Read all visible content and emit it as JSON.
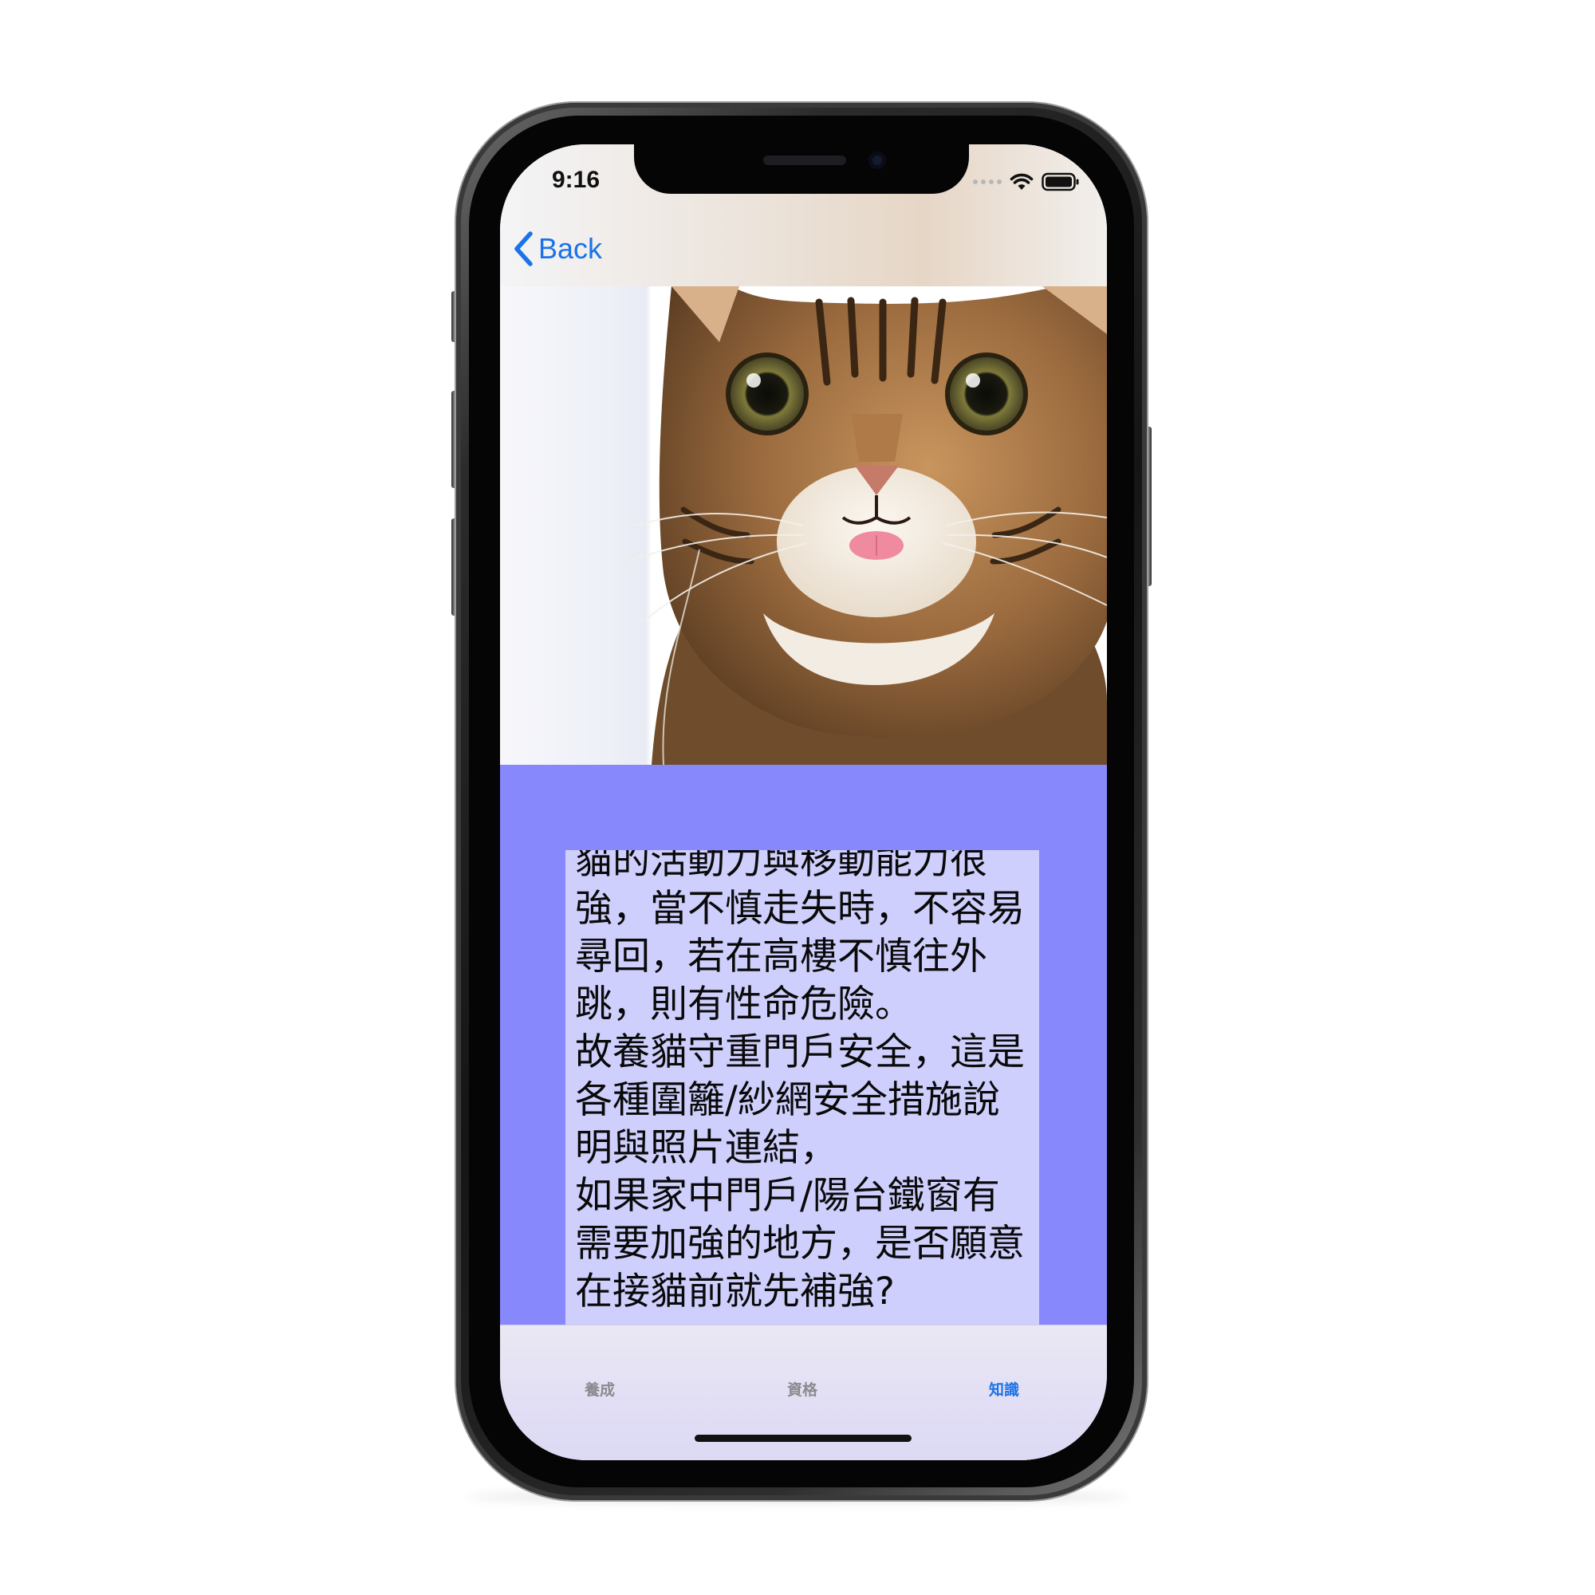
{
  "status_bar": {
    "time": "9:16"
  },
  "nav": {
    "back_label": "Back"
  },
  "content": {
    "body": "貓的活動力與移動能力很強，當不慎走失時，不容易尋回，若在高樓不慎往外跳，則有性命危險。\n故養貓守重門戶安全，這是各種圍籬/紗網安全措施說明與照片連結，\n如果家中門戶/陽台鐵窗有需要加強的地方，是否願意在接貓前就先補強?"
  },
  "tab_bar": {
    "tabs": [
      {
        "label": "養成",
        "active": false
      },
      {
        "label": "資格",
        "active": false
      },
      {
        "label": "知識",
        "active": true
      }
    ]
  },
  "colors": {
    "accent": "#1a73e8",
    "content_background": "#8888fd",
    "text_box_background": "#cfcffd",
    "inactive_tab": "#8a8a8e"
  },
  "icons": {
    "back": "chevron-left-icon",
    "wifi": "wifi-icon",
    "battery": "battery-icon",
    "signal": "cellular-signal-icon"
  }
}
